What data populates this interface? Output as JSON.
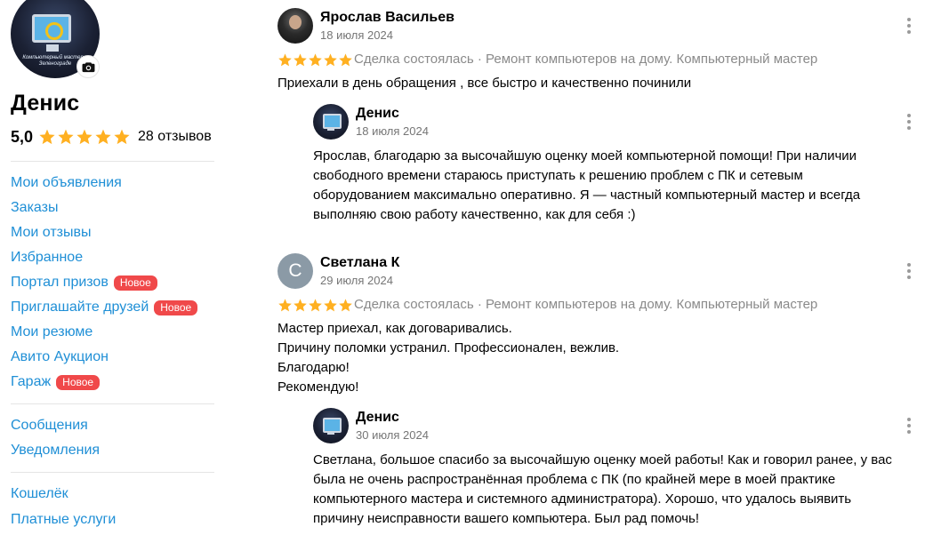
{
  "profile": {
    "name": "Денис",
    "rating": "5,0",
    "reviews_count": "28 отзывов",
    "avatar_text": "Компьютерный мастер в Зеленограде"
  },
  "colors": {
    "link": "#1f8fd6",
    "badge": "#f0494a",
    "star": "#ffb021",
    "muted": "#757575"
  },
  "nav": {
    "my_ads": "Мои объявления",
    "orders": "Заказы",
    "my_reviews": "Мои отзывы",
    "favorites": "Избранное",
    "prize_portal": "Портал призов",
    "invite_friends": "Приглашайте друзей",
    "my_resumes": "Мои резюме",
    "avito_auction": "Авито Аукцион",
    "garage": "Гараж",
    "messages": "Сообщения",
    "notifications": "Уведомления",
    "wallet": "Кошелёк",
    "paid_services": "Платные услуги",
    "badge_new": "Новое"
  },
  "reviews": [
    {
      "author": "Ярослав Васильев",
      "date": "18 июля 2024",
      "rating": 5,
      "deal": "Сделка состоялась · Ремонт компьютеров на дому. Компьютерный мастер",
      "text": "Приехали в день обращения , все быстро и качественно починили",
      "reply": {
        "author": "Денис",
        "date": "18 июля 2024",
        "lines": [
          "Ярослав, благодарю за высочайшую оценку моей компьютерной помощи! При наличии",
          "свободного времени стараюсь приступать к решению проблем с ПК и сетевым",
          "оборудованием максимально оперативно. Я — частный компьютерный мастер и всегда",
          "выполняю свою работу качественно, как для себя :)"
        ]
      }
    },
    {
      "author": "Светлана К",
      "avatar_letter": "С",
      "date": "29 июля 2024",
      "rating": 5,
      "deal": "Сделка состоялась · Ремонт компьютеров на дому. Компьютерный мастер",
      "lines": [
        "Мастер приехал, как договаривались.",
        "Причину поломки устранил. Профессионален, вежлив.",
        "Благодарю!",
        "Рекомендую!"
      ],
      "reply": {
        "author": "Денис",
        "date": "30 июля 2024",
        "lines": [
          "Светлана, большое спасибо за высочайшую оценку моей работы! Как и говорил ранее, у вас",
          "была не очень распространённая проблема с ПК (по крайней мере в моей практике",
          "компьютерного мастера и системного администратора). Хорошо, что удалось выявить",
          "причину неисправности вашего компьютера. Был рад помочь!"
        ]
      }
    }
  ]
}
